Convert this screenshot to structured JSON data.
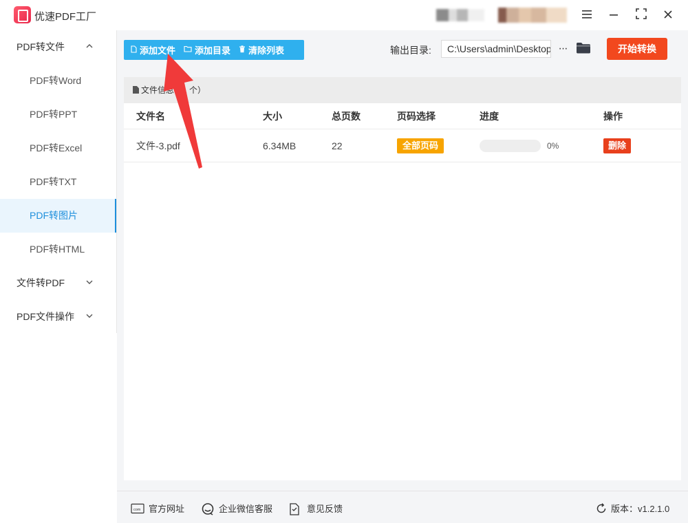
{
  "app": {
    "title": "优速PDF工厂"
  },
  "window": {
    "menu_icon": "hamburger-menu-icon",
    "min_icon": "minimize-icon",
    "max_icon": "maximize-icon",
    "close_icon": "close-icon"
  },
  "sidebar": {
    "groups": [
      {
        "label": "PDF转文件",
        "expanded": true,
        "items": [
          {
            "label": "PDF转Word"
          },
          {
            "label": "PDF转PPT"
          },
          {
            "label": "PDF转Excel"
          },
          {
            "label": "PDF转TXT"
          },
          {
            "label": "PDF转图片",
            "active": true
          },
          {
            "label": "PDF转HTML"
          }
        ]
      },
      {
        "label": "文件转PDF",
        "expanded": false
      },
      {
        "label": "PDF文件操作",
        "expanded": false
      }
    ]
  },
  "toolbar": {
    "add_file": "添加文件",
    "add_dir": "添加目录",
    "clear_list": "清除列表"
  },
  "output": {
    "label": "输出目录:",
    "path": "C:\\Users\\admin\\Desktop",
    "more": "···"
  },
  "start_button": "开始转换",
  "file_panel": {
    "header": "文件信息（1 个）",
    "columns": [
      "文件名",
      "大小",
      "总页数",
      "页码选择",
      "进度",
      "操作"
    ],
    "rows": [
      {
        "name": "文件-3.pdf",
        "size": "6.34MB",
        "pages": "22",
        "page_select": "全部页码",
        "progress": 0,
        "progress_text": "0%",
        "action": "删除"
      }
    ]
  },
  "footer": {
    "website": "官方网址",
    "wechat": "企业微信客服",
    "feedback": "意见反馈",
    "version": "版本：v1.2.1.0"
  },
  "colors": {
    "accent": "#2fb0ee",
    "start": "#f2481e",
    "badge": "#f7a400",
    "delete": "#e8401c",
    "arrow": "#f03a3a"
  }
}
